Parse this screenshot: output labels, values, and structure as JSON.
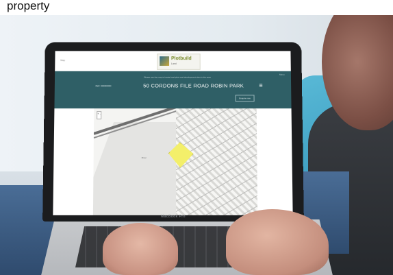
{
  "caption": "property",
  "laptop": {
    "brand_label": "MacBook Pro"
  },
  "site": {
    "small_left_text": "Map",
    "logo": {
      "name": "Plotbuild",
      "tagline": "Land"
    },
    "top_right_text": "Menu",
    "banner": {
      "info_line": "Please use the map to locate land plots and development sites in the area",
      "reference": "Ref: 00000000",
      "title": "50 CORDONS FILE ROAD ROBIN PARK",
      "menu_icon": "hamburger-menu-icon",
      "button_label": "Enquire now"
    },
    "map": {
      "zoom_control": "+ -",
      "area_label": "River",
      "highlight_color": "#f3ef6a"
    },
    "colors": {
      "banner": "#2f5f66",
      "accent": "#7a8c2c"
    }
  }
}
